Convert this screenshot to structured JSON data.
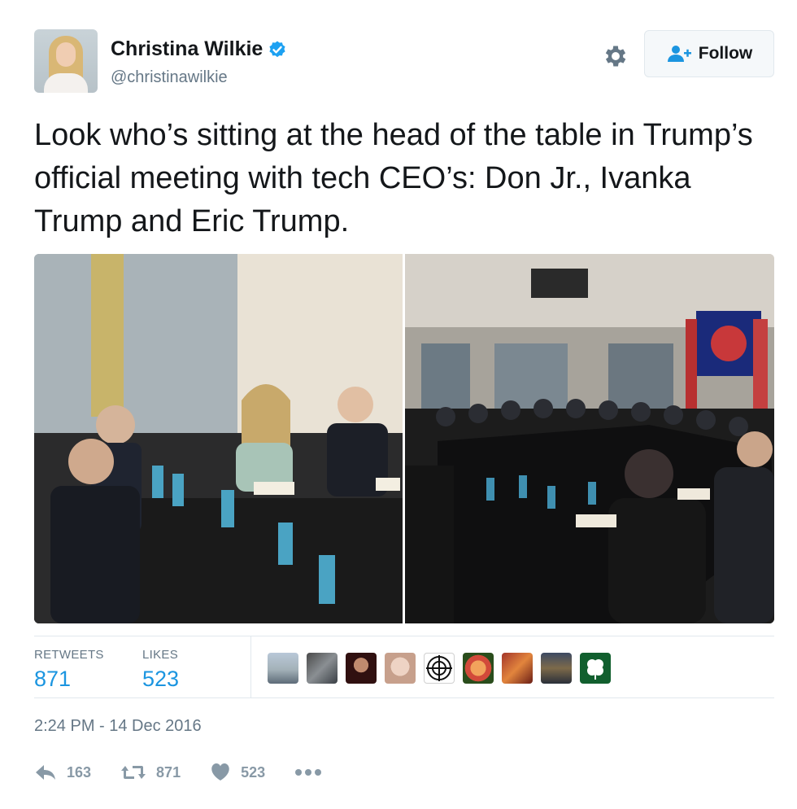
{
  "author": {
    "name": "Christina Wilkie",
    "handle": "@christinawilkie",
    "verified": true,
    "avatar_icon": "user-avatar"
  },
  "header": {
    "settings_icon": "gear-icon",
    "follow_label": "Follow",
    "follow_icon": "add-user-icon"
  },
  "tweet": {
    "text": "Look who’s sitting at the head of the table in Trump’s official meeting with tech CEO’s: Don Jr., Ivanka Trump and Eric Trump."
  },
  "media": {
    "photos": [
      "meeting-photo-left",
      "meeting-photo-right"
    ]
  },
  "stats": {
    "retweets_label": "RETWEETS",
    "retweets_value": "871",
    "likes_label": "LIKES",
    "likes_value": "523"
  },
  "timestamp": "2:24 PM - 14 Dec 2016",
  "actions": {
    "reply_count": "163",
    "retweet_count": "871",
    "like_count": "523"
  },
  "colors": {
    "accent": "#1b95e0",
    "verified": "#1da1f2",
    "muted": "#657786",
    "action": "#8899a6",
    "border": "#e1e8ed"
  }
}
